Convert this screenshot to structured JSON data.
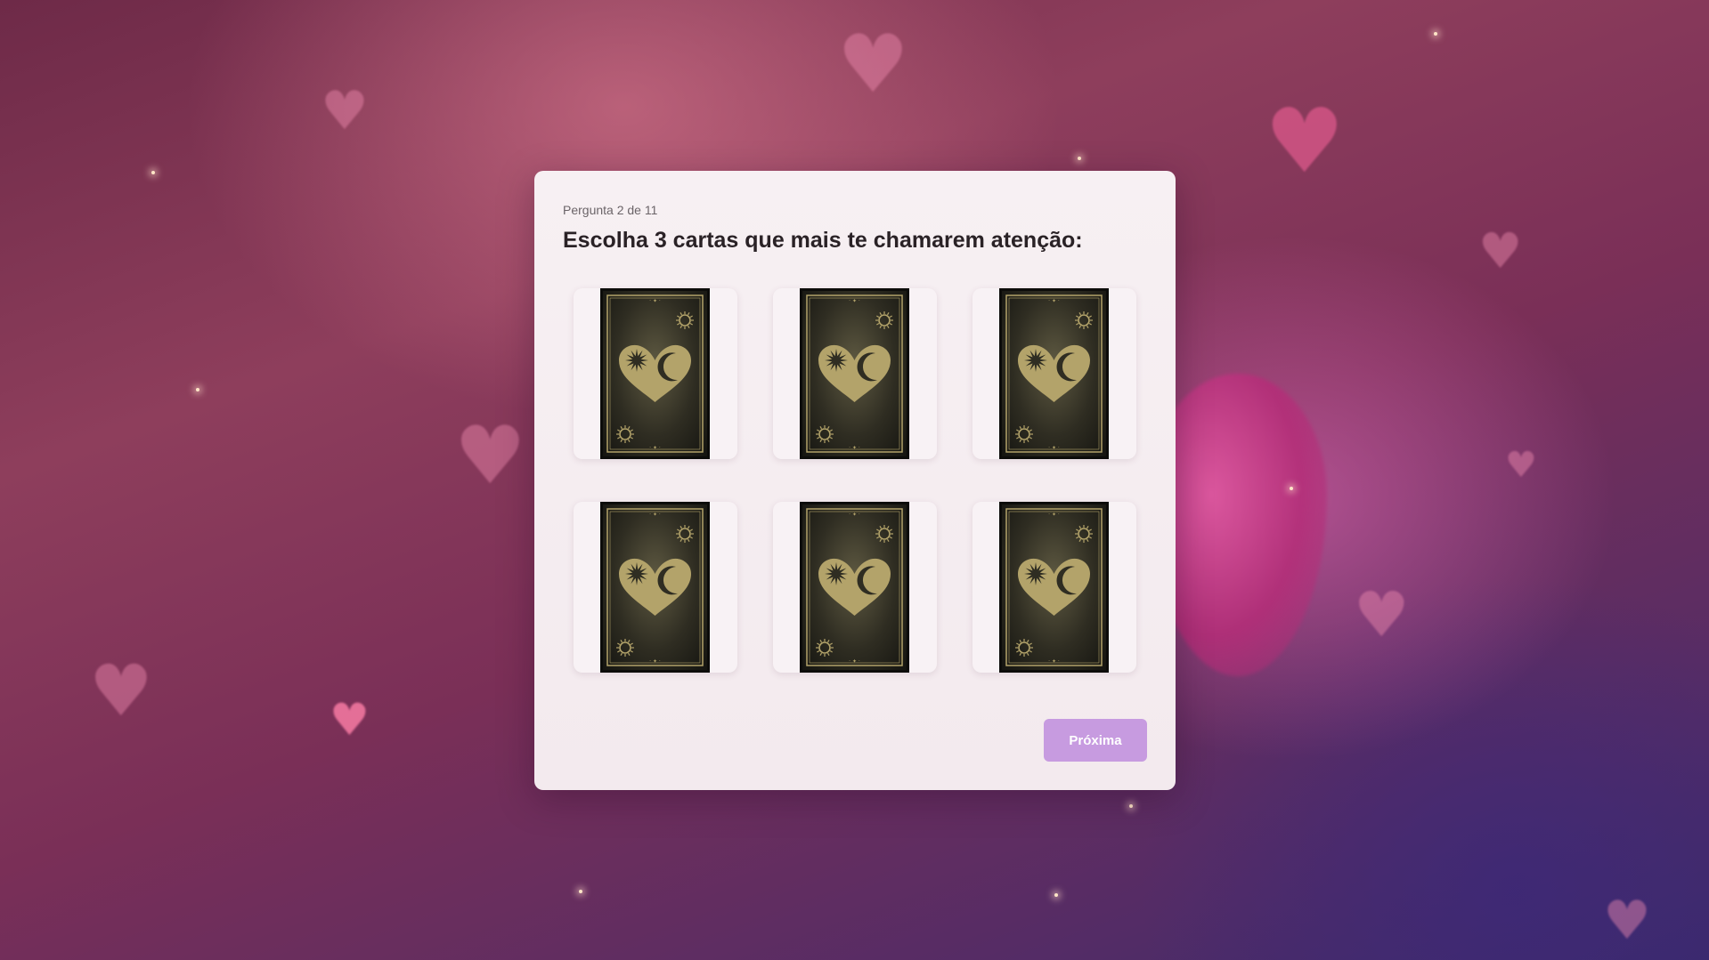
{
  "quiz": {
    "progress_label": "Pergunta 2 de 11",
    "question": "Escolha 3 cartas que mais te chamarem atenção:",
    "cards": [
      {
        "icon": "tarot-card-back"
      },
      {
        "icon": "tarot-card-back"
      },
      {
        "icon": "tarot-card-back"
      },
      {
        "icon": "tarot-card-back"
      },
      {
        "icon": "tarot-card-back"
      },
      {
        "icon": "tarot-card-back"
      }
    ],
    "next_label": "Próxima"
  },
  "colors": {
    "panel_bg": "#f5edf1",
    "accent_button": "#c79be0",
    "card_gold": "#b3a36a",
    "card_dark": "#2f2d22"
  }
}
